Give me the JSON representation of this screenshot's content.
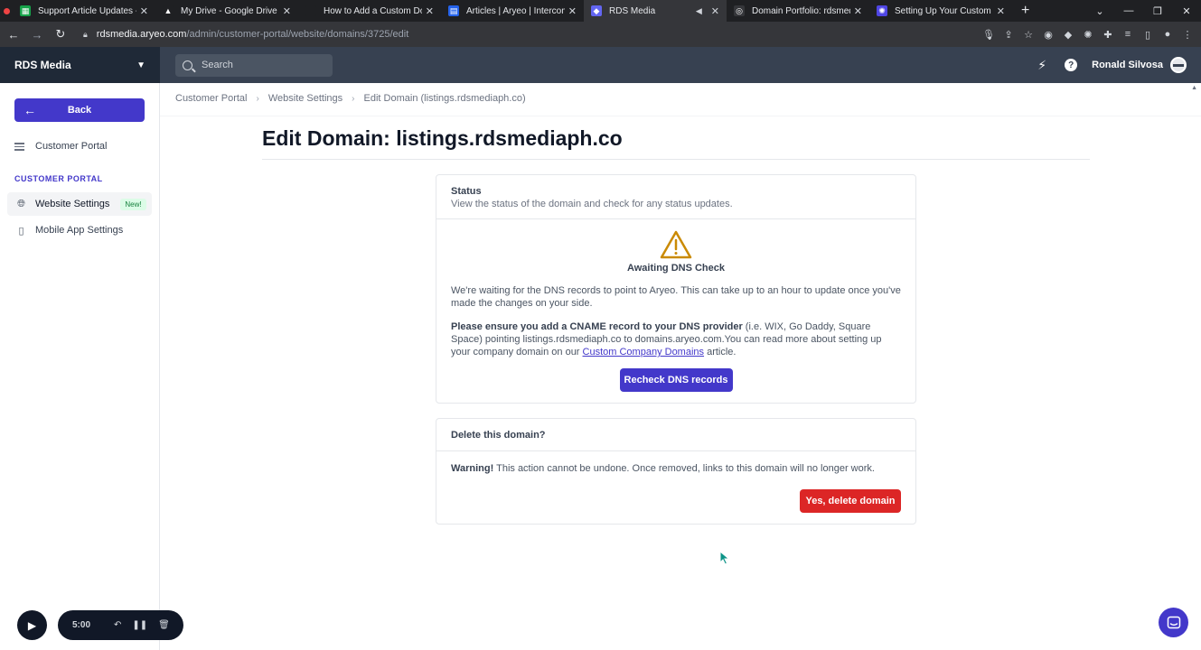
{
  "browser": {
    "tabs": [
      {
        "label": "Support Article Updates - Goo",
        "fav_color": "#16a34a",
        "fav_glyph": "▦"
      },
      {
        "label": "My Drive - Google Drive",
        "fav_color": "#1f2023",
        "fav_glyph": "▲"
      },
      {
        "label": "How to Add a Custom Domain",
        "fav_color": "#1f2023",
        "fav_glyph": ""
      },
      {
        "label": "Articles | Aryeo | Intercom",
        "fav_color": "#2563eb",
        "fav_glyph": "▤"
      },
      {
        "label": "RDS Media",
        "fav_color": "#6366f1",
        "fav_glyph": "◆"
      },
      {
        "label": "Domain Portfolio: rdsmediaph",
        "fav_color": "#35363a",
        "fav_glyph": "◎"
      },
      {
        "label": "Setting Up Your Custom Comp",
        "fav_color": "#4f46e5",
        "fav_glyph": "✺"
      }
    ],
    "url_host": "rdsmedia.aryeo.com",
    "url_path": "/admin/customer-portal/website/domains/3725/edit"
  },
  "header": {
    "brand": "RDS Media",
    "search_placeholder": "Search",
    "user_name": "Ronald Silvosa"
  },
  "sidebar": {
    "back_label": "Back",
    "customer_portal_link": "Customer Portal",
    "section_label": "CUSTOMER PORTAL",
    "items": [
      {
        "label": "Website Settings",
        "badge": "New!"
      },
      {
        "label": "Mobile App Settings"
      }
    ]
  },
  "recorder": {
    "time": "5:00"
  },
  "breadcrumb": [
    "Customer Portal",
    "Website Settings",
    "Edit Domain (listings.rdsmediaph.co)"
  ],
  "page_title": "Edit Domain: listings.rdsmediaph.co",
  "status_card": {
    "title": "Status",
    "subtitle": "View the status of the domain and check for any status updates.",
    "status_label": "Awaiting DNS Check",
    "para1": "We're waiting for the DNS records to point to Aryeo. This can take up to an hour to update once you've made the changes on your side.",
    "para2_bold": "Please ensure you add a CNAME record to your DNS provider",
    "para2_text": " (i.e. WIX, Go Daddy, Square Space) pointing listings.rdsmediaph.co to domains.aryeo.com.You can read more about setting up your company domain on our ",
    "para2_link": "Custom Company Domains",
    "para2_end": " article.",
    "button": "Recheck DNS records"
  },
  "delete_card": {
    "title": "Delete this domain?",
    "warning_bold": "Warning!",
    "warning_text": " This action cannot be undone. Once removed, links to this domain will no longer work.",
    "button": "Yes, delete domain"
  }
}
